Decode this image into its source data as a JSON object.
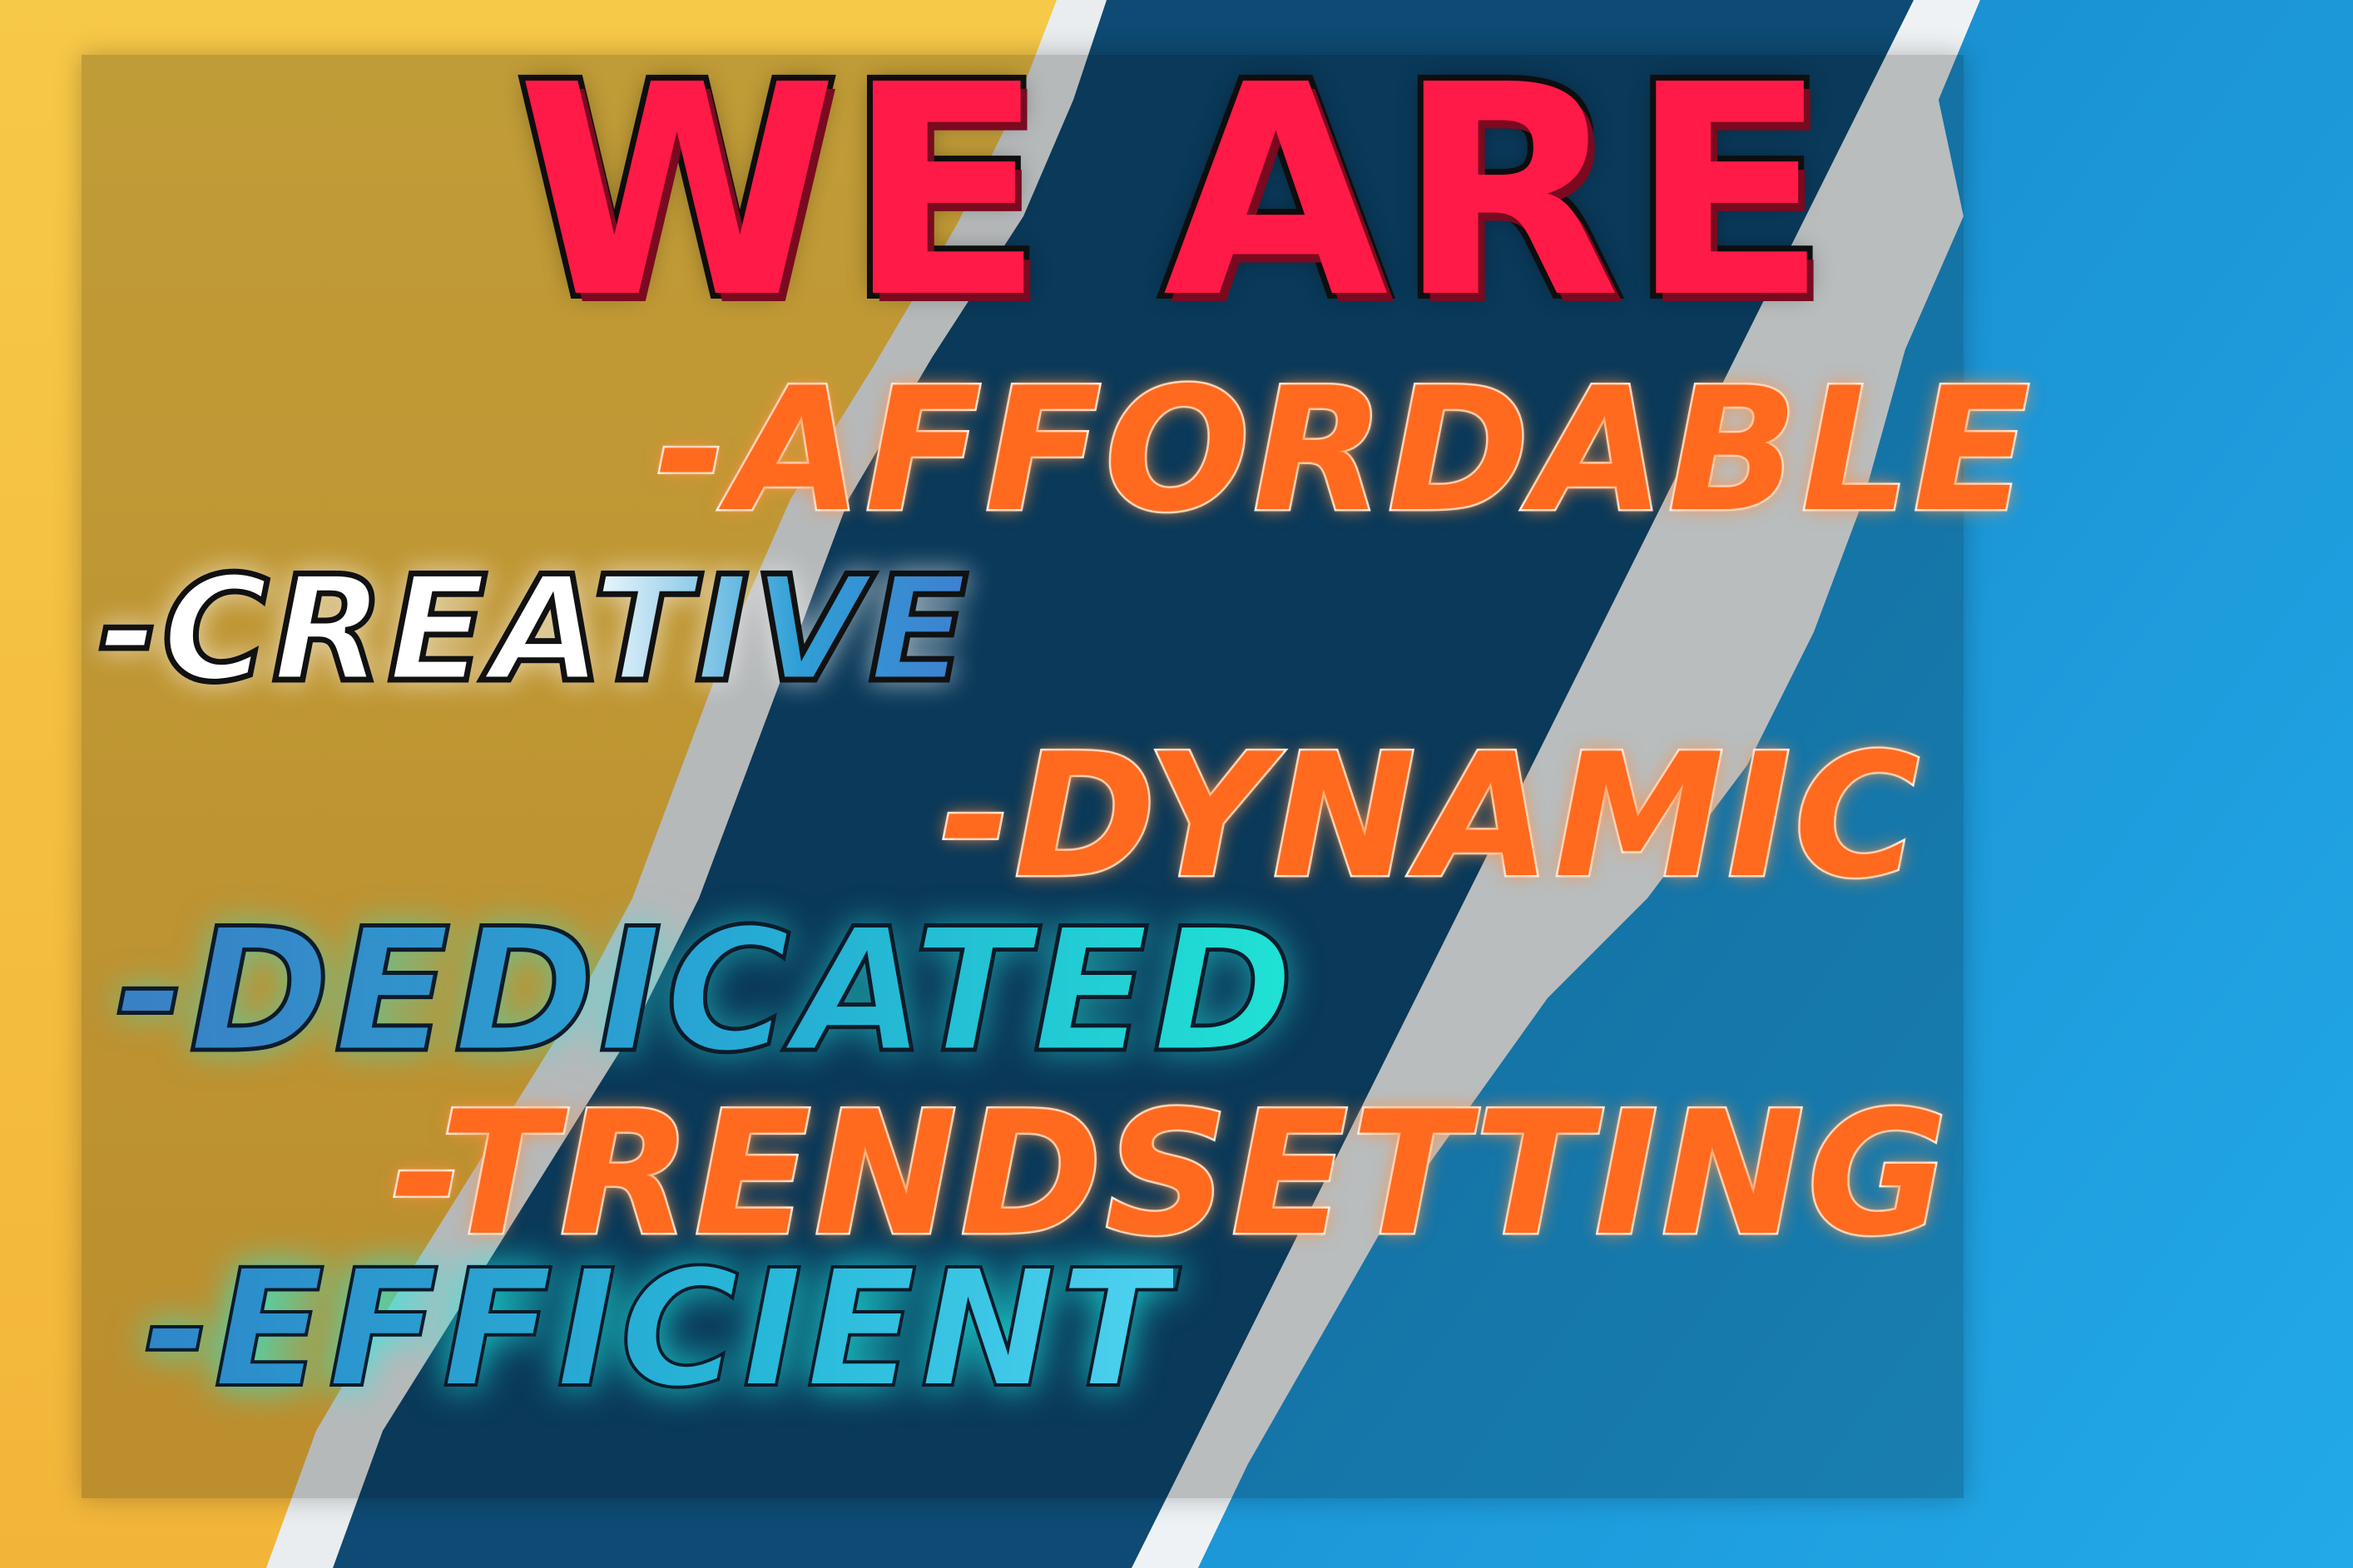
{
  "headline": "WE ARE",
  "words": [
    {
      "id": "affordable",
      "text": "-AFFORDABLE"
    },
    {
      "id": "creative",
      "text": "-CREATIVE"
    },
    {
      "id": "dynamic",
      "text": "-DYNAMIC"
    },
    {
      "id": "dedicated",
      "text": "-DEDICATED"
    },
    {
      "id": "trendsetting",
      "text": "-TRENDSETTING"
    },
    {
      "id": "efficient",
      "text": "-EFFICIENT"
    }
  ],
  "colors": {
    "background_yellow": "#f5c542",
    "background_navy": "#0e4a73",
    "background_blue": "#1e9fe0",
    "paper_white": "#e8ecef",
    "headline_red": "#ff1a47",
    "accent_orange": "#ff6a1f",
    "accent_cyan": "#1fe3d4"
  }
}
